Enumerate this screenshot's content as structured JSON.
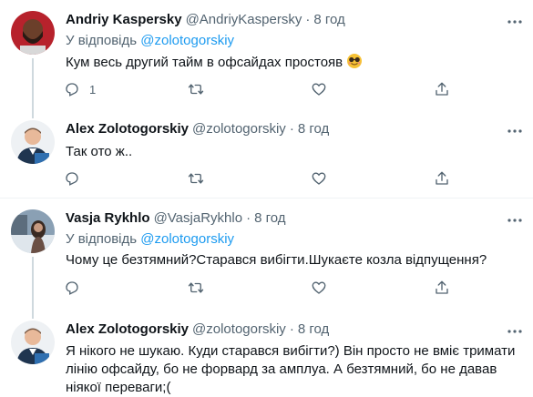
{
  "tweets": [
    {
      "name": "Andriy Kaspersky",
      "handle": "@AndriyKaspersky",
      "time": "8 год",
      "reply_prefix": "У відповідь",
      "reply_mention": "@zolotogorskiy",
      "text": "Кум весь другий тайм в офсайдах простояв",
      "emoji": "smiling-face-with-sunglasses",
      "reply_count": "1",
      "retweet_count": "",
      "like_count": ""
    },
    {
      "name": "Alex Zolotogorskiy",
      "handle": "@zolotogorskiy",
      "time": "8 год",
      "text": "Так ото ж..",
      "reply_count": "",
      "retweet_count": "",
      "like_count": ""
    },
    {
      "name": "Vasja Rykhlo",
      "handle": "@VasjaRykhlo",
      "time": "8 год",
      "reply_prefix": "У відповідь",
      "reply_mention": "@zolotogorskiy",
      "text": "Чому це безтямний?Старався вибігти.Шукаєте козла відпущення?",
      "reply_count": "",
      "retweet_count": "",
      "like_count": ""
    },
    {
      "name": "Alex Zolotogorskiy",
      "handle": "@zolotogorskiy",
      "time": "8 год",
      "text": "Я нікого не шукаю. Куди старався вибігти?) Він просто не вміє тримати лінію офсайду, бо не форвард за амплуа. А безтямний, бо не давав ніякої переваги;("
    }
  ],
  "sep": "·",
  "colors": {
    "accent": "#1d9bf0",
    "muted": "#536471",
    "text": "#0f1419"
  }
}
